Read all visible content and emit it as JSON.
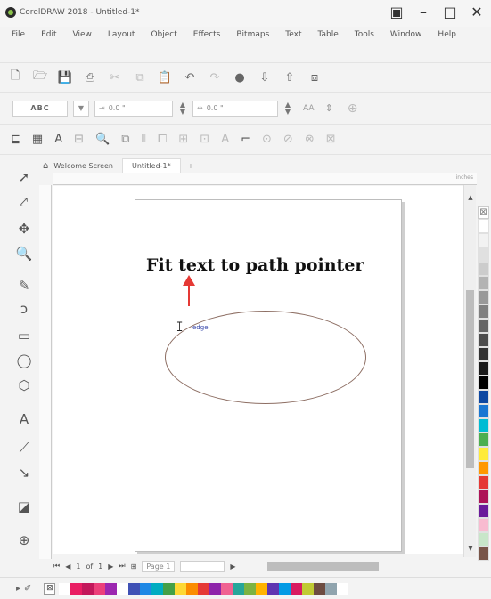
{
  "window": {
    "title": "CorelDRAW 2018 - Untitled-1*",
    "controls": [
      "▣",
      "–",
      "□",
      "✕"
    ]
  },
  "menubar": {
    "items": [
      "File",
      "Edit",
      "View",
      "Layout",
      "Object",
      "Effects",
      "Bitmaps",
      "Text",
      "Table",
      "Tools",
      "Window",
      "Help"
    ]
  },
  "property_bar": {
    "text_style_preview": "ABC",
    "distance_from_path": "0.0 \"",
    "offset": "0.0 \"",
    "ruler_units": "inches"
  },
  "document_tabs": {
    "home_tab": "Welcome Screen",
    "active_tab": "Untitled-1*",
    "add_tab": "+"
  },
  "canvas": {
    "annotation": "Fit text to path pointer",
    "cursor_label": "edge"
  },
  "page_navigation": {
    "current": "1",
    "of_label": "of",
    "total": "1",
    "page_tab": "Page 1"
  },
  "colors": {
    "arrow": "#e53935",
    "ellipse_stroke": "#8d6e63",
    "cursor_label": "#3949ab"
  },
  "palette_right": [
    "#ffffff",
    "#f2f2f2",
    "#e0e0e0",
    "#cccccc",
    "#b3b3b3",
    "#999999",
    "#808080",
    "#666666",
    "#4d4d4d",
    "#333333",
    "#1a1a1a",
    "#000000",
    "#0d47a1",
    "#1976d2",
    "#00bcd4",
    "#4caf50",
    "#ffeb3b",
    "#ff9800",
    "#e53935",
    "#ad1457",
    "#6a1b9a",
    "#f8bbd0",
    "#c8e6c9",
    "#795548"
  ],
  "palette_bottom": [
    "#ffffff",
    "#e91e63",
    "#c2185b",
    "#ec407a",
    "#9c27b0",
    "#ffffff",
    "#3f51b5",
    "#1e88e5",
    "#00acc1",
    "#43a047",
    "#fdd835",
    "#fb8c00",
    "#e53935",
    "#8e24aa",
    "#f06292",
    "#26a69a",
    "#7cb342",
    "#ffb300",
    "#5e35b1",
    "#039be5",
    "#d81b60",
    "#c0ca33",
    "#6d4c41",
    "#90a4ae",
    "#ffffff"
  ]
}
